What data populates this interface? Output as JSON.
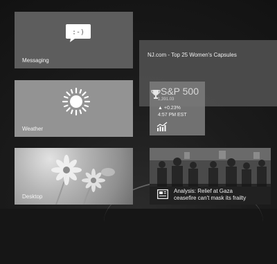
{
  "tiles": {
    "messaging": {
      "label": "Messaging",
      "icon": "speech-bubble-smiley-icon",
      "glyph": ":-)"
    },
    "weather": {
      "label": "Weather",
      "icon": "sun-icon"
    },
    "desktop": {
      "label": "Desktop",
      "image": "flowers"
    },
    "news": {
      "headline": "NJ.com - Top 25 Women's Capsules"
    },
    "finance": {
      "title": "S&P 500",
      "value": "1,391.03",
      "change": "▲ +0.23%",
      "time": "4:57 PM EST",
      "icons": [
        "trophy-icon",
        "chart-icon"
      ]
    },
    "analysis": {
      "line1": "Analysis: Relief at Gaza",
      "line2": "ceasefire can't mask its frailty",
      "icon": "newspaper-icon"
    }
  },
  "colors": {
    "background": "#161616",
    "tile_dark": "#5d5d5d",
    "tile_light": "#939393"
  }
}
